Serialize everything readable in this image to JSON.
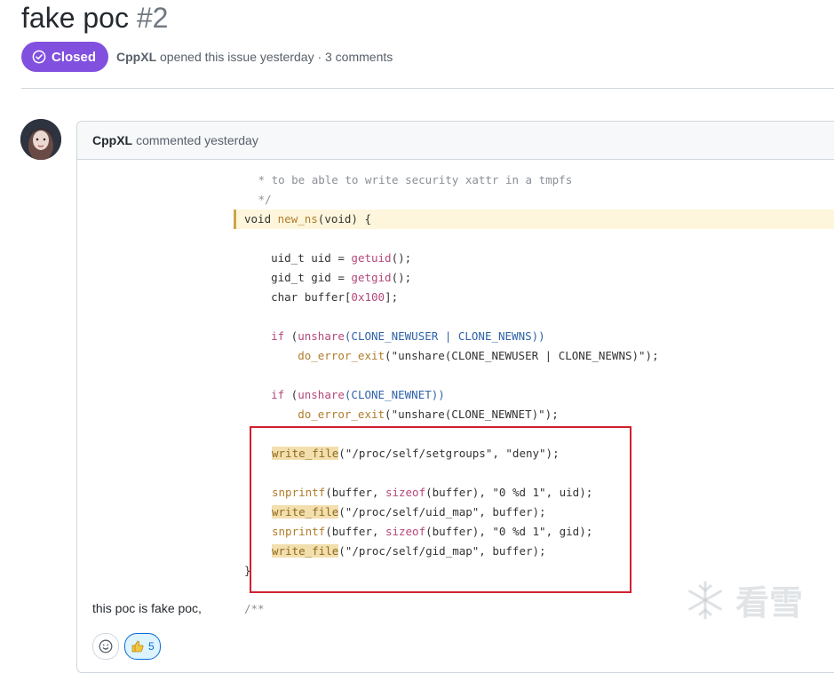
{
  "issue": {
    "title": "fake poc",
    "number": "#2",
    "status": "Closed",
    "author": "CppXL",
    "meta_text": "opened this issue yesterday · 3 comments",
    "status_color": "#8250df"
  },
  "comment": {
    "author": "CppXL",
    "action": "commented yesterday",
    "body_text": "this poc is fake poc,",
    "reaction_count": "5"
  },
  "code": {
    "comment_line1": " * to be able to write security xattr in a tmpfs",
    "comment_line2": " */",
    "func_sig_void": "void ",
    "func_sig_name": "new_ns",
    "func_sig_rest": "(void) {",
    "uid_pre": "    uid_t uid = ",
    "uid_fn": "getuid",
    "uid_post": "();",
    "gid_pre": "    gid_t gid = ",
    "gid_fn": "getgid",
    "gid_post": "();",
    "buf_pre": "    char buffer[",
    "buf_num": "0x100",
    "buf_post": "];",
    "if1_kw": "    if",
    "if1_mid": " (",
    "if1_fn": "unshare",
    "if1_args": "(CLONE_NEWUSER | CLONE_NEWNS))",
    "err1_fn": "        do_error_exit",
    "err1_args": "(\"unshare(CLONE_NEWUSER | CLONE_NEWNS)\");",
    "if2_kw": "    if",
    "if2_mid": " (",
    "if2_fn": "unshare",
    "if2_args": "(CLONE_NEWNET))",
    "err2_fn": "        do_error_exit",
    "err2_args": "(\"unshare(CLONE_NEWNET)\");",
    "wf1_fn": "write_file",
    "wf1_args": "(\"/proc/self/setgroups\", \"deny\");",
    "sp1_fn": "snprintf",
    "sp1_a": "(buffer, ",
    "sp1_kw": "sizeof",
    "sp1_b": "(buffer), \"0 %d 1\", uid);",
    "wf2_fn": "write_file",
    "wf2_args": "(\"/proc/self/uid_map\", buffer);",
    "sp2_fn": "snprintf",
    "sp2_a": "(buffer, ",
    "sp2_kw": "sizeof",
    "sp2_b": "(buffer), \"0 %d 1\", gid);",
    "wf3_fn": "write_file",
    "wf3_args": "(\"/proc/self/gid_map\", buffer);",
    "close_brace": "}",
    "trail_comment": "/**"
  },
  "watermark": {
    "text": "看雪"
  },
  "icons": [
    "check-circle-icon",
    "smiley-icon",
    "thumbs-up-icon",
    "snowflake-icon"
  ]
}
